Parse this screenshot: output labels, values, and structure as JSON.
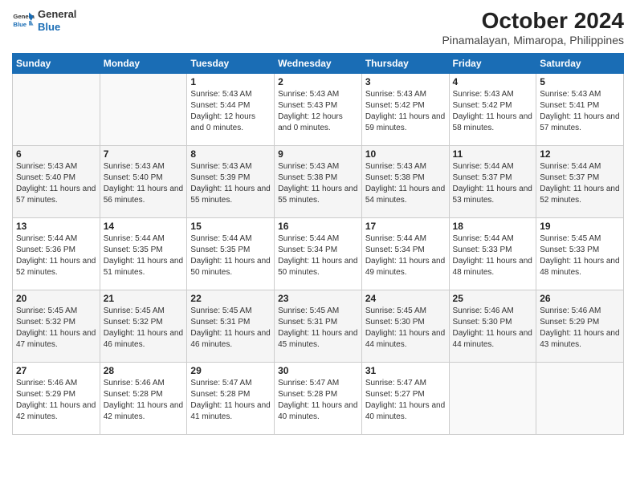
{
  "logo": {
    "line1": "General",
    "line2": "Blue"
  },
  "title": "October 2024",
  "subtitle": "Pinamalayan, Mimaropa, Philippines",
  "weekdays": [
    "Sunday",
    "Monday",
    "Tuesday",
    "Wednesday",
    "Thursday",
    "Friday",
    "Saturday"
  ],
  "weeks": [
    [
      {
        "day": "",
        "info": ""
      },
      {
        "day": "",
        "info": ""
      },
      {
        "day": "1",
        "info": "Sunrise: 5:43 AM\nSunset: 5:44 PM\nDaylight: 12 hours and 0 minutes."
      },
      {
        "day": "2",
        "info": "Sunrise: 5:43 AM\nSunset: 5:43 PM\nDaylight: 12 hours and 0 minutes."
      },
      {
        "day": "3",
        "info": "Sunrise: 5:43 AM\nSunset: 5:42 PM\nDaylight: 11 hours and 59 minutes."
      },
      {
        "day": "4",
        "info": "Sunrise: 5:43 AM\nSunset: 5:42 PM\nDaylight: 11 hours and 58 minutes."
      },
      {
        "day": "5",
        "info": "Sunrise: 5:43 AM\nSunset: 5:41 PM\nDaylight: 11 hours and 57 minutes."
      }
    ],
    [
      {
        "day": "6",
        "info": "Sunrise: 5:43 AM\nSunset: 5:40 PM\nDaylight: 11 hours and 57 minutes."
      },
      {
        "day": "7",
        "info": "Sunrise: 5:43 AM\nSunset: 5:40 PM\nDaylight: 11 hours and 56 minutes."
      },
      {
        "day": "8",
        "info": "Sunrise: 5:43 AM\nSunset: 5:39 PM\nDaylight: 11 hours and 55 minutes."
      },
      {
        "day": "9",
        "info": "Sunrise: 5:43 AM\nSunset: 5:38 PM\nDaylight: 11 hours and 55 minutes."
      },
      {
        "day": "10",
        "info": "Sunrise: 5:43 AM\nSunset: 5:38 PM\nDaylight: 11 hours and 54 minutes."
      },
      {
        "day": "11",
        "info": "Sunrise: 5:44 AM\nSunset: 5:37 PM\nDaylight: 11 hours and 53 minutes."
      },
      {
        "day": "12",
        "info": "Sunrise: 5:44 AM\nSunset: 5:37 PM\nDaylight: 11 hours and 52 minutes."
      }
    ],
    [
      {
        "day": "13",
        "info": "Sunrise: 5:44 AM\nSunset: 5:36 PM\nDaylight: 11 hours and 52 minutes."
      },
      {
        "day": "14",
        "info": "Sunrise: 5:44 AM\nSunset: 5:35 PM\nDaylight: 11 hours and 51 minutes."
      },
      {
        "day": "15",
        "info": "Sunrise: 5:44 AM\nSunset: 5:35 PM\nDaylight: 11 hours and 50 minutes."
      },
      {
        "day": "16",
        "info": "Sunrise: 5:44 AM\nSunset: 5:34 PM\nDaylight: 11 hours and 50 minutes."
      },
      {
        "day": "17",
        "info": "Sunrise: 5:44 AM\nSunset: 5:34 PM\nDaylight: 11 hours and 49 minutes."
      },
      {
        "day": "18",
        "info": "Sunrise: 5:44 AM\nSunset: 5:33 PM\nDaylight: 11 hours and 48 minutes."
      },
      {
        "day": "19",
        "info": "Sunrise: 5:45 AM\nSunset: 5:33 PM\nDaylight: 11 hours and 48 minutes."
      }
    ],
    [
      {
        "day": "20",
        "info": "Sunrise: 5:45 AM\nSunset: 5:32 PM\nDaylight: 11 hours and 47 minutes."
      },
      {
        "day": "21",
        "info": "Sunrise: 5:45 AM\nSunset: 5:32 PM\nDaylight: 11 hours and 46 minutes."
      },
      {
        "day": "22",
        "info": "Sunrise: 5:45 AM\nSunset: 5:31 PM\nDaylight: 11 hours and 46 minutes."
      },
      {
        "day": "23",
        "info": "Sunrise: 5:45 AM\nSunset: 5:31 PM\nDaylight: 11 hours and 45 minutes."
      },
      {
        "day": "24",
        "info": "Sunrise: 5:45 AM\nSunset: 5:30 PM\nDaylight: 11 hours and 44 minutes."
      },
      {
        "day": "25",
        "info": "Sunrise: 5:46 AM\nSunset: 5:30 PM\nDaylight: 11 hours and 44 minutes."
      },
      {
        "day": "26",
        "info": "Sunrise: 5:46 AM\nSunset: 5:29 PM\nDaylight: 11 hours and 43 minutes."
      }
    ],
    [
      {
        "day": "27",
        "info": "Sunrise: 5:46 AM\nSunset: 5:29 PM\nDaylight: 11 hours and 42 minutes."
      },
      {
        "day": "28",
        "info": "Sunrise: 5:46 AM\nSunset: 5:28 PM\nDaylight: 11 hours and 42 minutes."
      },
      {
        "day": "29",
        "info": "Sunrise: 5:47 AM\nSunset: 5:28 PM\nDaylight: 11 hours and 41 minutes."
      },
      {
        "day": "30",
        "info": "Sunrise: 5:47 AM\nSunset: 5:28 PM\nDaylight: 11 hours and 40 minutes."
      },
      {
        "day": "31",
        "info": "Sunrise: 5:47 AM\nSunset: 5:27 PM\nDaylight: 11 hours and 40 minutes."
      },
      {
        "day": "",
        "info": ""
      },
      {
        "day": "",
        "info": ""
      }
    ]
  ]
}
